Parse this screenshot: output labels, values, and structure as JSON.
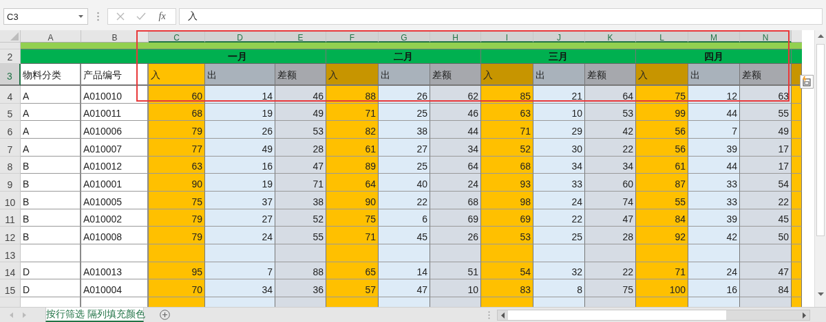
{
  "name_box": {
    "value": "C3"
  },
  "formula_bar": {
    "function_label": "fx",
    "value": "入"
  },
  "columns": [
    {
      "label": "A",
      "selected": false
    },
    {
      "label": "B",
      "selected": false
    },
    {
      "label": "C",
      "selected": true
    },
    {
      "label": "D",
      "selected": true
    },
    {
      "label": "E",
      "selected": true
    },
    {
      "label": "F",
      "selected": true
    },
    {
      "label": "G",
      "selected": true
    },
    {
      "label": "H",
      "selected": true
    },
    {
      "label": "I",
      "selected": true
    },
    {
      "label": "J",
      "selected": true
    },
    {
      "label": "K",
      "selected": true
    },
    {
      "label": "L",
      "selected": true
    },
    {
      "label": "M",
      "selected": true
    },
    {
      "label": "N",
      "selected": true
    }
  ],
  "month_row": {
    "number": "2"
  },
  "months": [
    {
      "label": "一月"
    },
    {
      "label": "二月"
    },
    {
      "label": "三月"
    },
    {
      "label": "四月"
    }
  ],
  "header_row": {
    "number": "3",
    "selected": true,
    "cells": [
      {
        "text": "物料分类",
        "kind": "label"
      },
      {
        "text": "产品编号",
        "kind": "label"
      },
      {
        "text": "入",
        "kind": "in",
        "highlighted": false
      },
      {
        "text": "出",
        "kind": "out",
        "highlighted": true
      },
      {
        "text": "差额",
        "kind": "diff",
        "highlighted": true
      },
      {
        "text": "入",
        "kind": "in",
        "highlighted": true
      },
      {
        "text": "出",
        "kind": "out",
        "highlighted": true
      },
      {
        "text": "差额",
        "kind": "diff",
        "highlighted": true
      },
      {
        "text": "入",
        "kind": "in",
        "highlighted": true
      },
      {
        "text": "出",
        "kind": "out",
        "highlighted": true
      },
      {
        "text": "差额",
        "kind": "diff",
        "highlighted": true
      },
      {
        "text": "入",
        "kind": "in",
        "highlighted": true
      },
      {
        "text": "出",
        "kind": "out",
        "highlighted": true
      },
      {
        "text": "差额",
        "kind": "diff",
        "highlighted": true
      },
      {
        "kind": "in",
        "highlighted": true
      }
    ]
  },
  "rows": [
    {
      "number": "4",
      "category": "A",
      "code": "A010010",
      "values": [
        "60",
        "14",
        "46",
        "88",
        "26",
        "62",
        "85",
        "21",
        "64",
        "75",
        "12",
        "63"
      ]
    },
    {
      "number": "5",
      "category": "A",
      "code": "A010011",
      "values": [
        "68",
        "19",
        "49",
        "71",
        "25",
        "46",
        "63",
        "10",
        "53",
        "99",
        "44",
        "55"
      ]
    },
    {
      "number": "6",
      "category": "A",
      "code": "A010006",
      "values": [
        "79",
        "26",
        "53",
        "82",
        "38",
        "44",
        "71",
        "29",
        "42",
        "56",
        "7",
        "49"
      ]
    },
    {
      "number": "7",
      "category": "A",
      "code": "A010007",
      "values": [
        "77",
        "49",
        "28",
        "61",
        "27",
        "34",
        "52",
        "30",
        "22",
        "56",
        "39",
        "17"
      ]
    },
    {
      "number": "8",
      "category": "B",
      "code": "A010012",
      "values": [
        "63",
        "16",
        "47",
        "89",
        "25",
        "64",
        "68",
        "34",
        "34",
        "61",
        "44",
        "17"
      ]
    },
    {
      "number": "9",
      "category": "B",
      "code": "A010001",
      "values": [
        "90",
        "19",
        "71",
        "64",
        "40",
        "24",
        "93",
        "33",
        "60",
        "87",
        "33",
        "54"
      ]
    },
    {
      "number": "10",
      "category": "B",
      "code": "A010005",
      "values": [
        "75",
        "37",
        "38",
        "90",
        "22",
        "68",
        "98",
        "24",
        "74",
        "55",
        "33",
        "22"
      ]
    },
    {
      "number": "11",
      "category": "B",
      "code": "A010002",
      "values": [
        "79",
        "27",
        "52",
        "75",
        "6",
        "69",
        "69",
        "22",
        "47",
        "84",
        "39",
        "45"
      ]
    },
    {
      "number": "12",
      "category": "B",
      "code": "A010008",
      "values": [
        "79",
        "24",
        "55",
        "71",
        "45",
        "26",
        "53",
        "25",
        "28",
        "92",
        "42",
        "50"
      ]
    },
    {
      "number": "13"
    },
    {
      "number": "14",
      "category": "D",
      "code": "A010013",
      "values": [
        "95",
        "7",
        "88",
        "65",
        "14",
        "51",
        "54",
        "32",
        "22",
        "71",
        "24",
        "47"
      ]
    },
    {
      "number": "15",
      "category": "D",
      "code": "A010004",
      "values": [
        "70",
        "34",
        "36",
        "57",
        "47",
        "10",
        "83",
        "8",
        "75",
        "100",
        "16",
        "84"
      ]
    }
  ],
  "sheet_tabs": [
    {
      "label": "按行筛选 隔列填充颜色",
      "selected": true
    }
  ]
}
